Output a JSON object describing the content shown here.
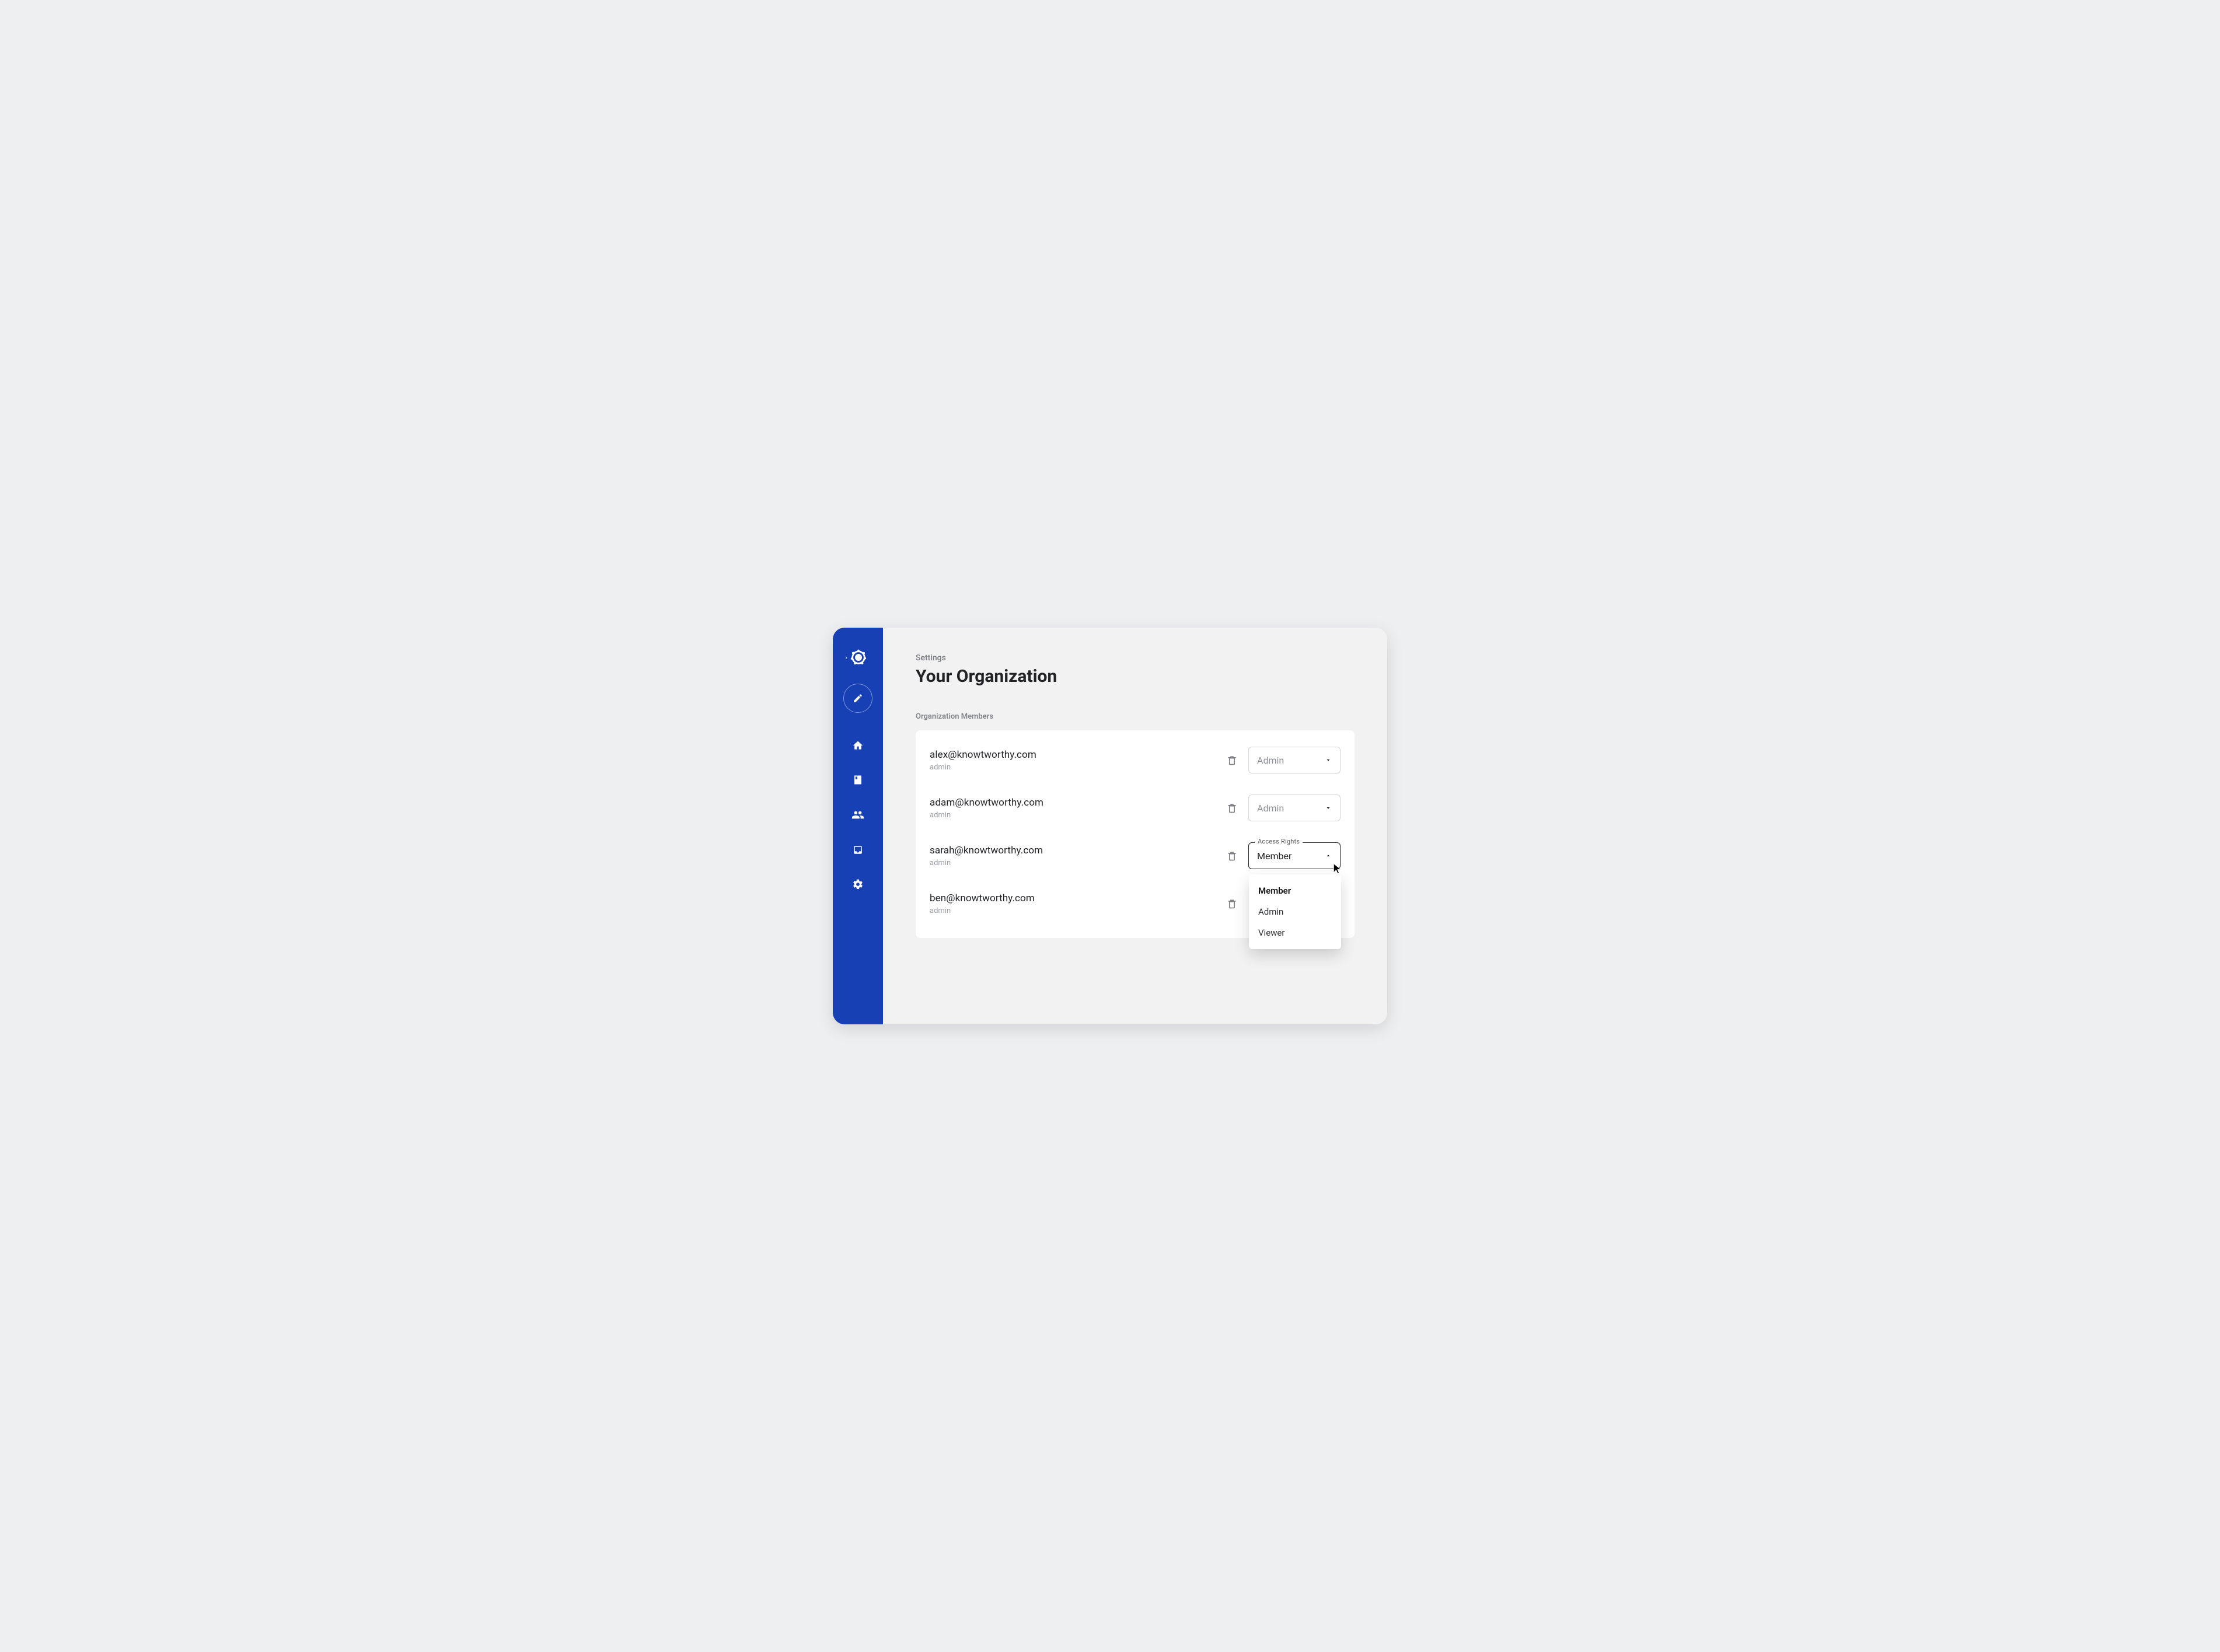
{
  "header": {
    "eyebrow": "Settings",
    "title": "Your Organization"
  },
  "section_label": "Organization Members",
  "members": [
    {
      "email": "alex@knowtworthy.com",
      "sub": "admin",
      "role": "Admin",
      "open": false
    },
    {
      "email": "adam@knowtworthy.com",
      "sub": "admin",
      "role": "Admin",
      "open": false
    },
    {
      "email": "sarah@knowtworthy.com",
      "sub": "admin",
      "role": "Member",
      "open": true,
      "floating_label": "Access Rights"
    },
    {
      "email": "ben@knowtworthy.com",
      "sub": "admin",
      "role": "",
      "open": false,
      "hide_select": true
    }
  ],
  "dropdown_options": [
    "Member",
    "Admin",
    "Viewer"
  ],
  "sidebar": {
    "icons": [
      "logo",
      "edit",
      "home",
      "book",
      "people",
      "inbox",
      "gear"
    ]
  }
}
